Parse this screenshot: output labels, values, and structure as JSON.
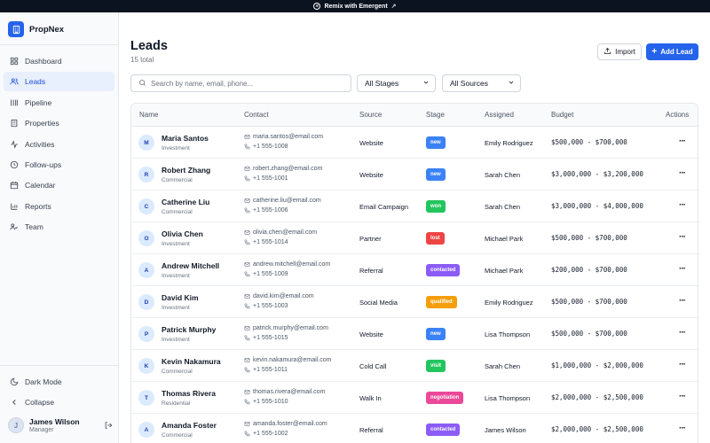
{
  "topbar": {
    "label": "Remix with Emergent"
  },
  "brand": {
    "name": "PropNex"
  },
  "nav": [
    {
      "label": "Dashboard",
      "icon": "grid-icon",
      "active": false
    },
    {
      "label": "Leads",
      "icon": "users-icon",
      "active": true
    },
    {
      "label": "Pipeline",
      "icon": "pipeline-icon",
      "active": false
    },
    {
      "label": "Properties",
      "icon": "building-icon",
      "active": false
    },
    {
      "label": "Activities",
      "icon": "activity-icon",
      "active": false
    },
    {
      "label": "Follow-ups",
      "icon": "clock-icon",
      "active": false
    },
    {
      "label": "Calendar",
      "icon": "calendar-icon",
      "active": false
    },
    {
      "label": "Reports",
      "icon": "bar-chart-icon",
      "active": false
    },
    {
      "label": "Team",
      "icon": "team-icon",
      "active": false
    }
  ],
  "sidebar_bottom": {
    "dark_mode": "Dark Mode",
    "collapse": "Collapse"
  },
  "user": {
    "initial": "J",
    "name": "James Wilson",
    "role": "Manager"
  },
  "page": {
    "title": "Leads",
    "subtitle": "15 total"
  },
  "actions": {
    "import": "Import",
    "add": "Add Lead"
  },
  "filters": {
    "search_placeholder": "Search by name, email, phone...",
    "stage": "All Stages",
    "source": "All Sources"
  },
  "table": {
    "columns": [
      "Name",
      "Contact",
      "Source",
      "Stage",
      "Assigned",
      "Budget",
      "Actions"
    ],
    "rows": [
      {
        "initial": "M",
        "name": "Maria Santos",
        "type": "Investment",
        "email": "maria.santos@email.com",
        "phone": "+1 555-1008",
        "source": "Website",
        "stage": "new",
        "stage_color": "#3b82f6",
        "assigned": "Emily Rodriguez",
        "budget": "$500,000 - $700,000"
      },
      {
        "initial": "R",
        "name": "Robert Zhang",
        "type": "Commercial",
        "email": "robert.zhang@email.com",
        "phone": "+1 555-1001",
        "source": "Website",
        "stage": "new",
        "stage_color": "#3b82f6",
        "assigned": "Sarah Chen",
        "budget": "$3,000,000 - $3,200,000"
      },
      {
        "initial": "C",
        "name": "Catherine Liu",
        "type": "Commercial",
        "email": "catherine.liu@email.com",
        "phone": "+1 555-1006",
        "source": "Email Campaign",
        "stage": "won",
        "stage_color": "#22c55e",
        "assigned": "Sarah Chen",
        "budget": "$3,000,000 - $4,000,000"
      },
      {
        "initial": "O",
        "name": "Olivia Chen",
        "type": "Investment",
        "email": "olivia.chen@email.com",
        "phone": "+1 555-1014",
        "source": "Partner",
        "stage": "lost",
        "stage_color": "#ef4444",
        "assigned": "Michael Park",
        "budget": "$500,000 - $700,000"
      },
      {
        "initial": "A",
        "name": "Andrew Mitchell",
        "type": "Investment",
        "email": "andrew.mitchell@email.com",
        "phone": "+1 555-1009",
        "source": "Referral",
        "stage": "contacted",
        "stage_color": "#8b5cf6",
        "assigned": "Michael Park",
        "budget": "$200,000 - $700,000"
      },
      {
        "initial": "D",
        "name": "David Kim",
        "type": "Investment",
        "email": "david.kim@email.com",
        "phone": "+1 555-1003",
        "source": "Social Media",
        "stage": "qualified",
        "stage_color": "#f59e0b",
        "assigned": "Emily Rodriguez",
        "budget": "$500,000 - $700,000"
      },
      {
        "initial": "P",
        "name": "Patrick Murphy",
        "type": "Investment",
        "email": "patrick.murphy@email.com",
        "phone": "+1 555-1015",
        "source": "Website",
        "stage": "new",
        "stage_color": "#3b82f6",
        "assigned": "Lisa Thompson",
        "budget": "$500,000 - $700,000"
      },
      {
        "initial": "K",
        "name": "Kevin Nakamura",
        "type": "Commercial",
        "email": "kevin.nakamura@email.com",
        "phone": "+1 555-1011",
        "source": "Cold Call",
        "stage": "visit",
        "stage_color": "#22c55e",
        "assigned": "Sarah Chen",
        "budget": "$1,000,000 - $2,000,000"
      },
      {
        "initial": "T",
        "name": "Thomas Rivera",
        "type": "Residential",
        "email": "thomas.rivera@email.com",
        "phone": "+1 555-1010",
        "source": "Walk In",
        "stage": "negotiation",
        "stage_color": "#ec4899",
        "assigned": "Lisa Thompson",
        "budget": "$2,000,000 - $2,500,000"
      },
      {
        "initial": "A",
        "name": "Amanda Foster",
        "type": "Commercial",
        "email": "amanda.foster@email.com",
        "phone": "+1 555-1002",
        "source": "Referral",
        "stage": "contacted",
        "stage_color": "#8b5cf6",
        "assigned": "James Wilson",
        "budget": "$2,000,000 - $2,500,000"
      }
    ]
  }
}
